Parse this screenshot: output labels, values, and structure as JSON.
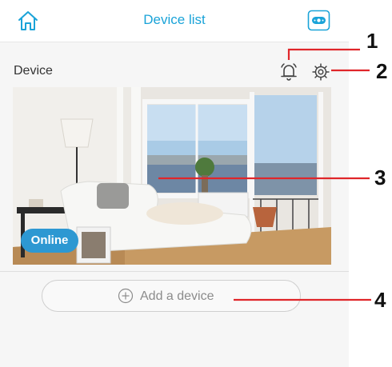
{
  "header": {
    "title": "Device list"
  },
  "device": {
    "label": "Device",
    "status": "Online"
  },
  "actions": {
    "add_device_label": "Add a device"
  },
  "callouts": [
    "1",
    "2",
    "3",
    "4"
  ],
  "colors": {
    "accent": "#1aa3d8",
    "online_badge": "#2d98d2",
    "callout_line": "#e0262a"
  }
}
